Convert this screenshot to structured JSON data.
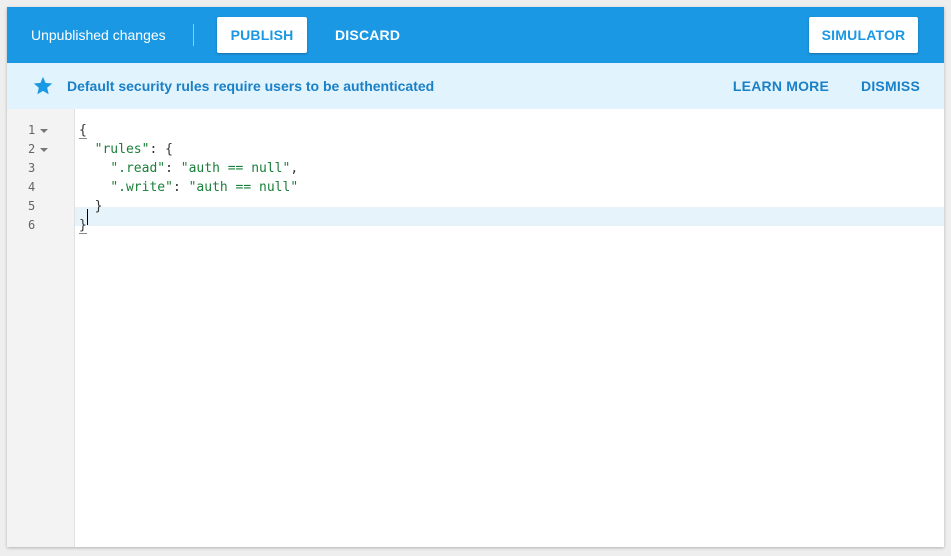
{
  "toolbar": {
    "status": "Unpublished changes",
    "publish_label": "PUBLISH",
    "discard_label": "DISCARD",
    "simulator_label": "SIMULATOR",
    "background_color": "#1a98e4"
  },
  "banner": {
    "icon": "star-icon",
    "message": "Default security rules require users to be authenticated",
    "learn_more_label": "LEARN MORE",
    "dismiss_label": "DISMISS",
    "background_color": "#e1f3fd",
    "text_color": "#1a80c7"
  },
  "editor": {
    "line_numbers": [
      "1",
      "2",
      "3",
      "4",
      "5",
      "6"
    ],
    "lines": {
      "l1": {
        "brace": "{"
      },
      "l2": {
        "key": "\"rules\"",
        "sep": ": {"
      },
      "l3": {
        "key": "\".read\"",
        "sep": ": ",
        "value": "\"auth == null\"",
        "end": ","
      },
      "l4": {
        "key": "\".write\"",
        "sep": ": ",
        "value": "\"auth == null\""
      },
      "l5": {
        "brace": "}"
      },
      "l6": {
        "brace": "}"
      }
    },
    "string_color": "#1a7f3a"
  }
}
